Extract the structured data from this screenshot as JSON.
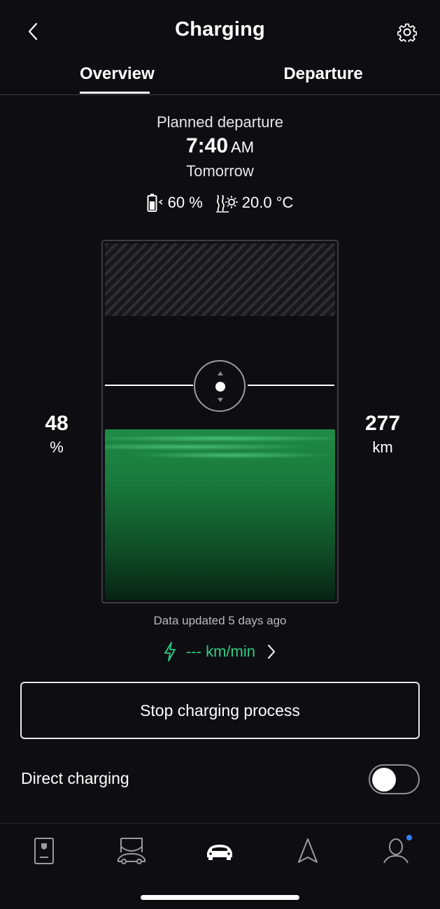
{
  "header": {
    "title": "Charging",
    "back_icon": "chevron-left-icon",
    "settings_icon": "gear-icon"
  },
  "tabs": [
    {
      "label": "Overview",
      "active": true
    },
    {
      "label": "Departure",
      "active": false
    }
  ],
  "departure": {
    "planned_label": "Planned departure",
    "time": "7:40",
    "ampm": "AM",
    "day": "Tomorrow",
    "target_soc": "60 %",
    "climate_temp": "20.0 °C"
  },
  "battery": {
    "current_percent": "48",
    "percent_unit": "%",
    "range_value": "277",
    "range_unit": "km",
    "fill_level": 0.48,
    "target_level": 0.6,
    "max_limit_level": 0.8
  },
  "status": {
    "updated": "Data updated 5 days ago",
    "rate": "--- km/min"
  },
  "actions": {
    "stop_label": "Stop charging process",
    "direct_label": "Direct charging",
    "direct_enabled": false
  },
  "nav": {
    "items": [
      "phone-key-icon",
      "car-service-icon",
      "car-icon",
      "navigation-icon",
      "profile-icon"
    ],
    "active": "car-icon",
    "badge_color": "#2f80ff"
  },
  "colors": {
    "accent_green": "#2ecc84",
    "fill_green": "#1f8a46",
    "background": "#0e0e12"
  }
}
